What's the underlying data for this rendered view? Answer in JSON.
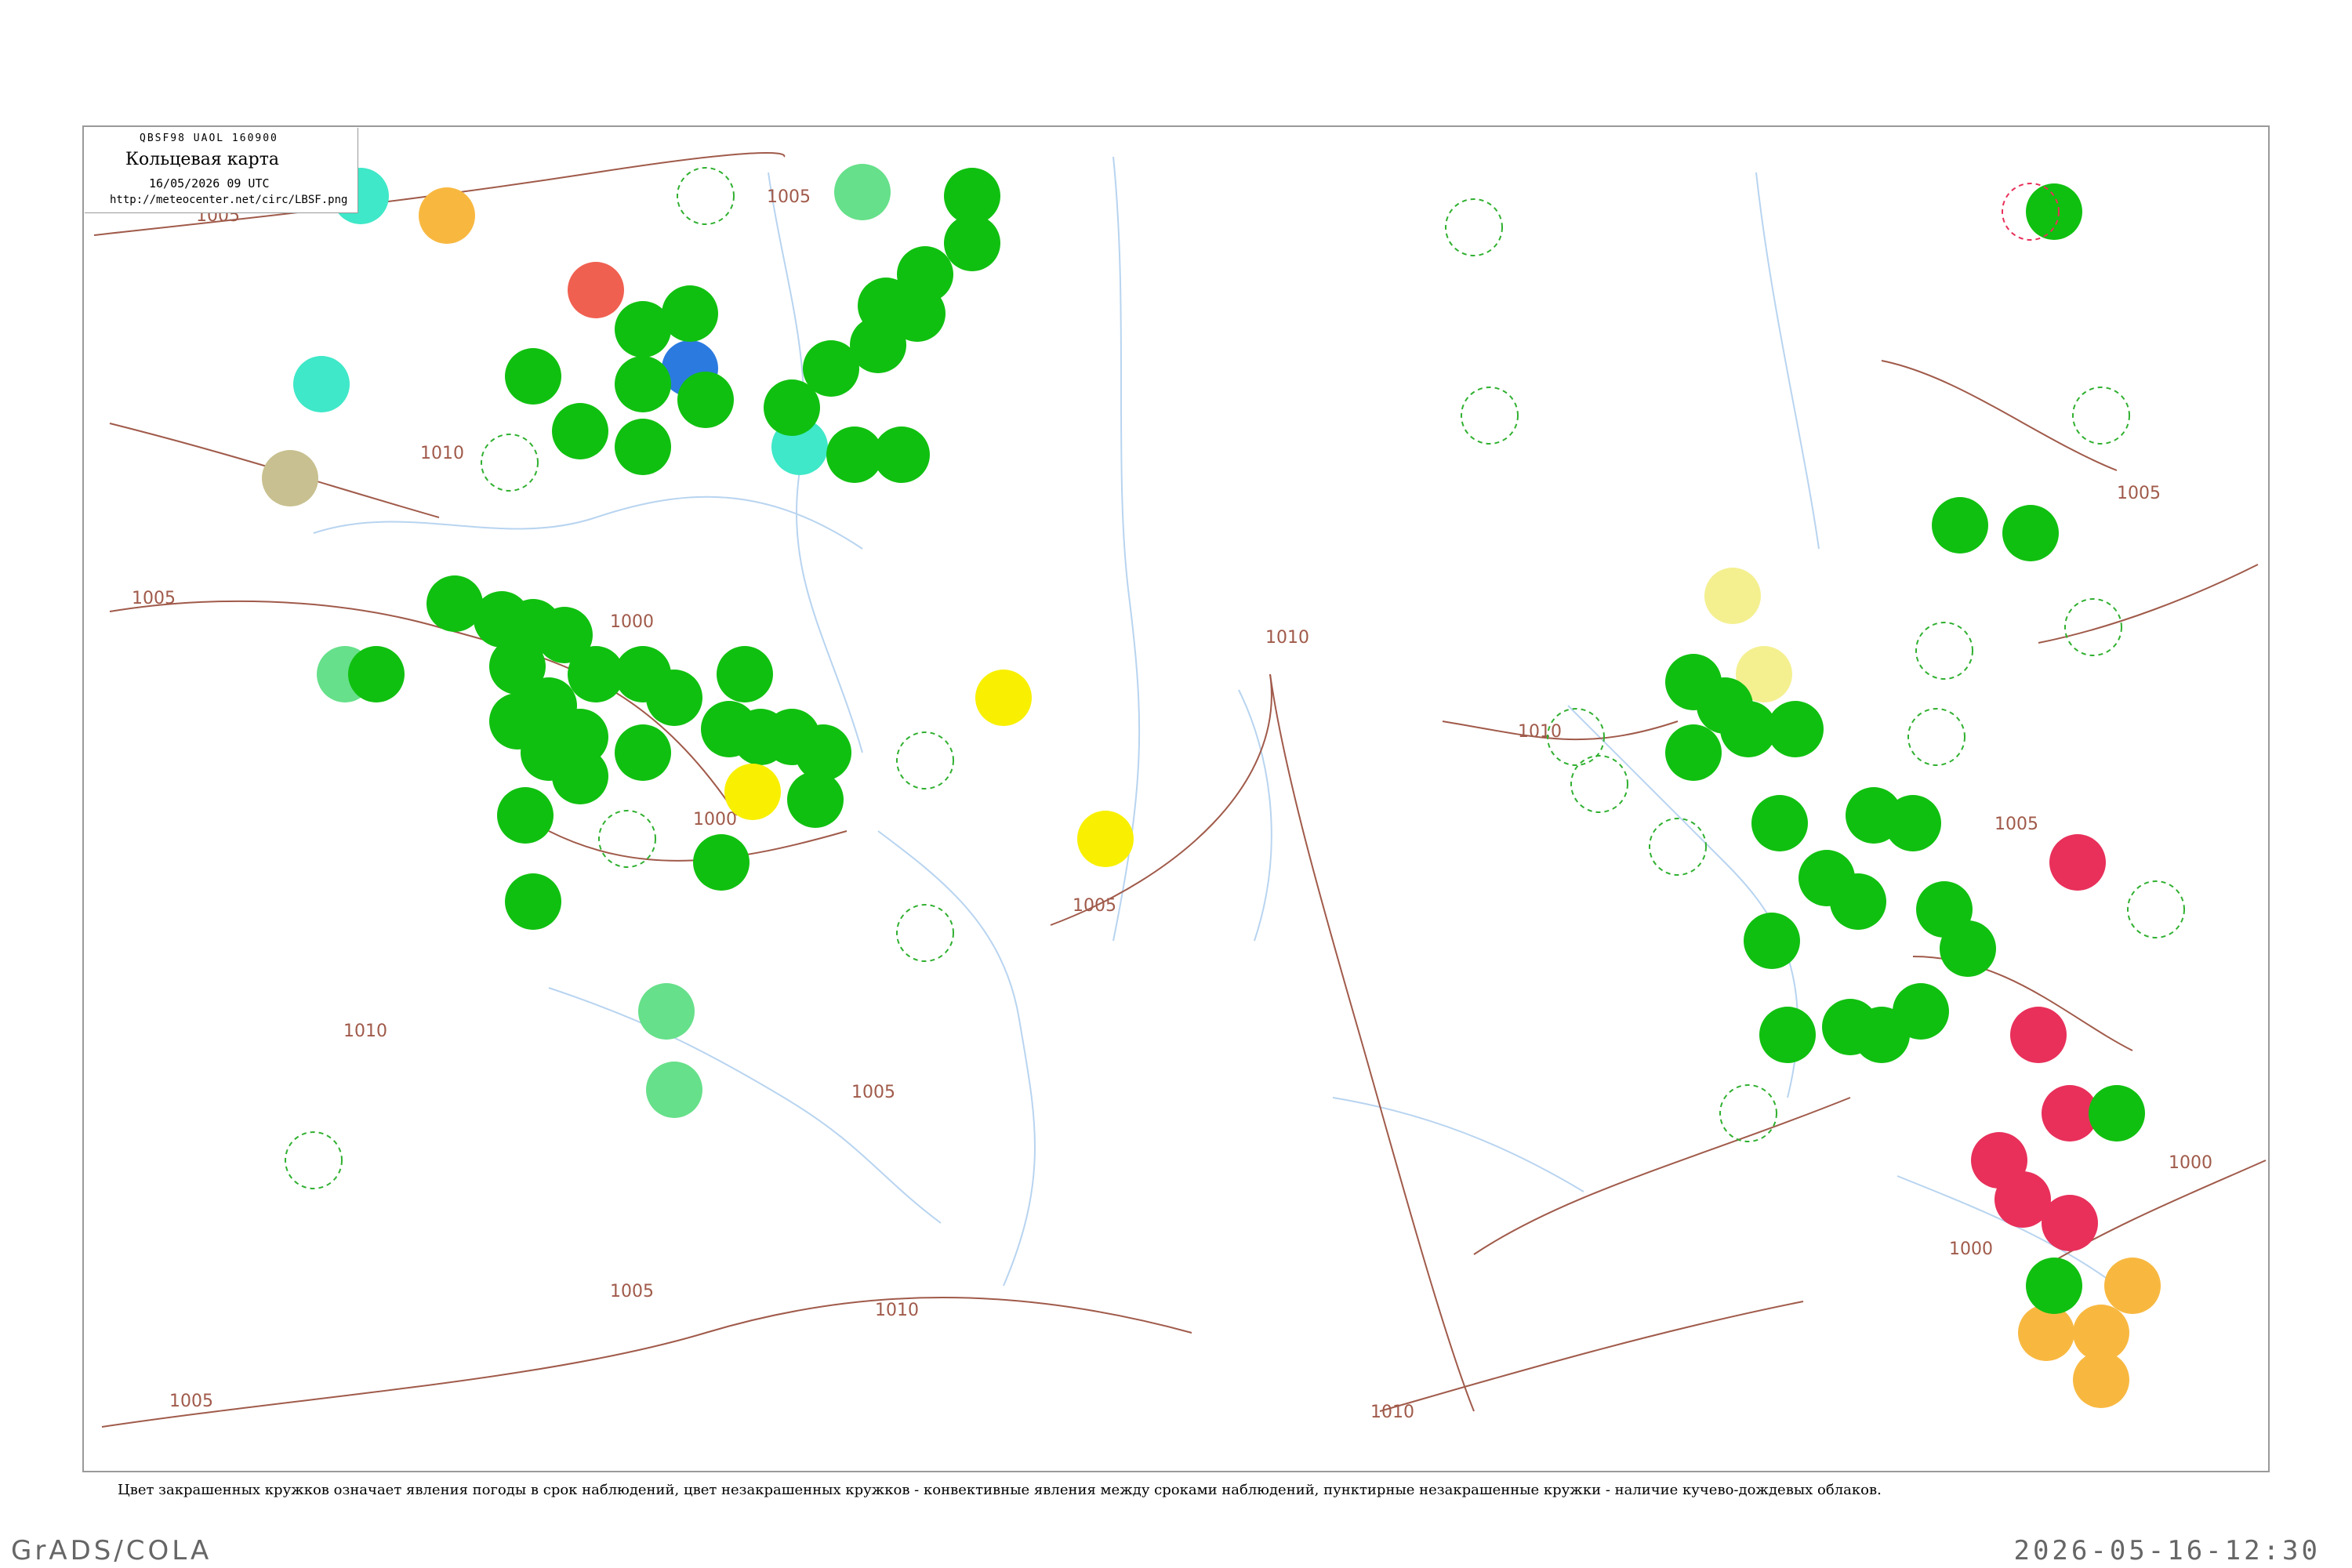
{
  "header": {
    "code": "QBSF98  UAOL  160900",
    "title": "Кольцевая карта",
    "date": "16/05/2026 09 UTC",
    "url": "http://meteocenter.net/circ/LBSF.png"
  },
  "caption": "Цвет закрашенных кружков означает явления погоды в срок наблюдений, цвет незакрашенных кружков - конвективные явления между сроками наблюдений, пунктирные незакрашенные кружки - наличие кучево-дождевых облаков.",
  "footer": {
    "left": "GrADS/COLA",
    "right": "2026-05-16-12:30"
  },
  "colors": {
    "green": "#10c010",
    "light_green": "#66e08a",
    "cyan": "#3ee8c8",
    "orange": "#f8b840",
    "red": "#e8305a",
    "yellow": "#f8f000",
    "pale_yellow": "#f4f090",
    "blue": "#2a7ae0",
    "olive": "#c8c090",
    "salmon": "#f06050",
    "isobar": "#a05a4a",
    "river": "#b8d4f0"
  },
  "isobar_labels": [
    "1005",
    "1010",
    "1005",
    "1000",
    "1000",
    "1005",
    "1010",
    "1005",
    "1005",
    "1010",
    "1005",
    "1010",
    "1005",
    "1010",
    "1005",
    "1000",
    "1000",
    "1005",
    "1010"
  ],
  "symbols": {
    "filled_green": "rain-shower",
    "filled_red": "thunderstorm",
    "filled_orange": "haze",
    "filled_yellow": "fog",
    "dashed_green": "cumulonimbus",
    "solid_green": "convective-between-obs"
  }
}
